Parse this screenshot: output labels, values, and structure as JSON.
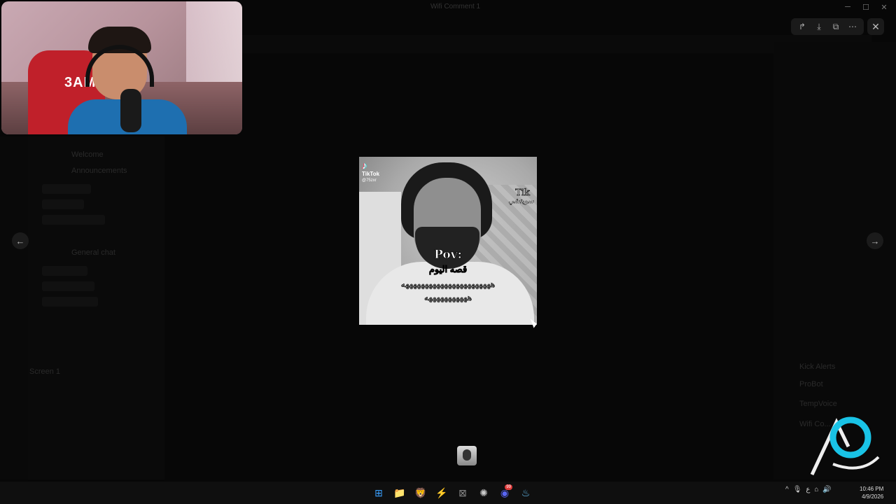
{
  "window": {
    "title": "Wifi Comment 1",
    "controls": {
      "minimize": "─",
      "maximize": "☐",
      "close": "✕"
    }
  },
  "channels": {
    "items": [
      "Welcome",
      "Announcements",
      "General chat"
    ],
    "voice": "Screen 1"
  },
  "members": {
    "bots": [
      "Kick Alerts",
      "ProBot",
      "TempVoice",
      "Wifi Co..."
    ]
  },
  "webcam": {
    "chair_text": "3AM"
  },
  "viewer": {
    "toolbar": [
      {
        "name": "forward-icon",
        "glyph": "↱"
      },
      {
        "name": "download-icon",
        "glyph": "⤓"
      },
      {
        "name": "open-external-icon",
        "glyph": "⧉"
      },
      {
        "name": "more-icon",
        "glyph": "⋯"
      }
    ],
    "close_glyph": "✕",
    "prev_glyph": "←",
    "next_glyph": "→",
    "media": {
      "tiktok_icon": "♪",
      "tiktok_word": "TikTok",
      "tiktok_handle": "@75zxr",
      "tag_tik": "Tik",
      "tag_arabic": "سويتشي",
      "caption_pov": "Pov:",
      "caption_line1": "قصه اليوم",
      "caption_line2": "هههههههههههههههههههههههه",
      "caption_line3": "هههههههههههه"
    }
  },
  "taskbar": {
    "apps": [
      {
        "name": "windows-start-icon",
        "glyph": "⊞",
        "color": "#3aa0ff"
      },
      {
        "name": "file-explorer-icon",
        "glyph": "📁",
        "color": "#f2c744"
      },
      {
        "name": "brave-browser-icon",
        "glyph": "🦁",
        "color": "#fb542b"
      },
      {
        "name": "fl-app-icon",
        "glyph": "⚡",
        "color": "#f5a623"
      },
      {
        "name": "xbox-app-icon",
        "glyph": "⊠",
        "color": "#8a8a8a"
      },
      {
        "name": "chatgpt-icon",
        "glyph": "✺",
        "color": "#cccccc"
      },
      {
        "name": "discord-icon",
        "glyph": "◉",
        "color": "#5865f2",
        "badge": "99"
      },
      {
        "name": "steam-icon",
        "glyph": "♨",
        "color": "#66c0f4"
      }
    ],
    "tray": {
      "chevron": "^",
      "mic": "🎙",
      "lang": "ع",
      "wifi": "⌂",
      "volume": "🔊"
    },
    "time": "10:46 PM",
    "date": "4/9/2026"
  }
}
